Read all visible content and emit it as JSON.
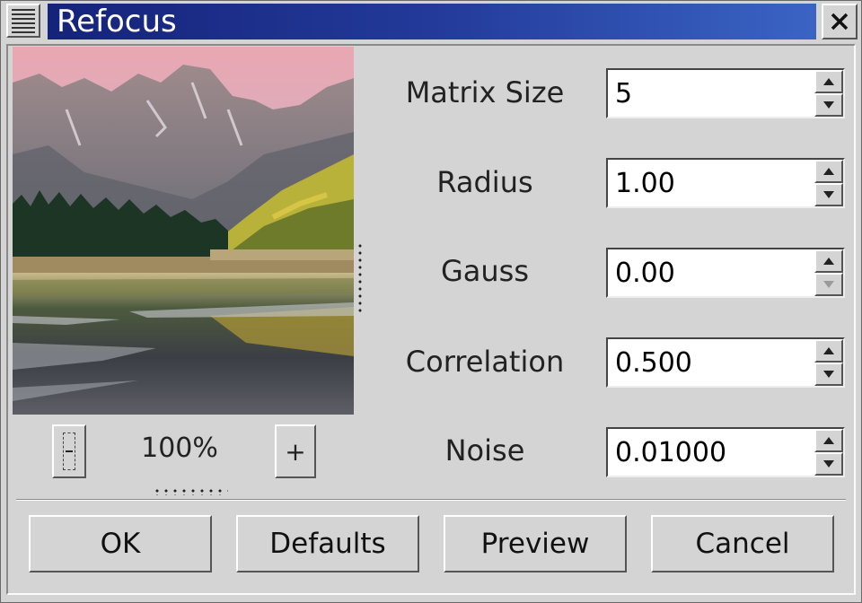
{
  "window": {
    "title": "Refocus"
  },
  "preview": {
    "zoom_level": "100%",
    "zoom_out_label": "−",
    "zoom_in_label": "+"
  },
  "parameters": [
    {
      "label": "Matrix Size",
      "value": "5"
    },
    {
      "label": "Radius",
      "value": "1.00"
    },
    {
      "label": "Gauss",
      "value": "0.00"
    },
    {
      "label": "Correlation",
      "value": "0.500"
    },
    {
      "label": "Noise",
      "value": "0.01000"
    }
  ],
  "buttons": {
    "ok": "OK",
    "defaults": "Defaults",
    "preview": "Preview",
    "cancel": "Cancel"
  },
  "colors": {
    "title_gradient_start": "#15237a",
    "title_gradient_end": "#3a64c4",
    "window_bg": "#d4d4d4"
  }
}
